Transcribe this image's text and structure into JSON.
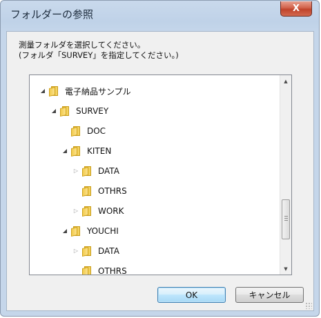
{
  "window": {
    "title": "フォルダーの参照",
    "close_label": "X"
  },
  "instructions": {
    "line1": "測量フォルダを選択してください。",
    "line2": "(フォルダ「SURVEY」を指定してください。)"
  },
  "tree": {
    "items": [
      {
        "label": "電子納品サンプル",
        "state": "expanded"
      },
      {
        "label": "SURVEY",
        "state": "expanded"
      },
      {
        "label": "DOC",
        "state": "none"
      },
      {
        "label": "KITEN",
        "state": "expanded"
      },
      {
        "label": "DATA",
        "state": "collapsed"
      },
      {
        "label": "OTHRS",
        "state": "none"
      },
      {
        "label": "WORK",
        "state": "collapsed"
      },
      {
        "label": "YOUCHI",
        "state": "expanded"
      },
      {
        "label": "DATA",
        "state": "collapsed"
      },
      {
        "label": "OTHRS",
        "state": "none"
      }
    ],
    "icons": {
      "expanded": "triangle-down-icon",
      "collapsed": "triangle-right-icon",
      "folder": "folder-icon"
    }
  },
  "buttons": {
    "ok_label": "OK",
    "cancel_label": "キャンセル"
  },
  "colors": {
    "titlebar": "#c5d6ea",
    "close_button": "#c0432b",
    "folder": "#f2cb4c",
    "default_button_border": "#3c7fb1"
  }
}
